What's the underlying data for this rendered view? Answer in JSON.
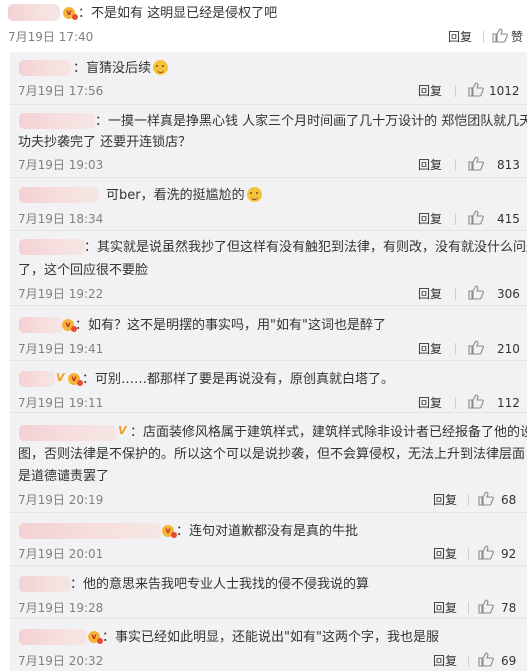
{
  "main_comment": {
    "text": "：不是如有 这明显已经是侵权了吧",
    "time": "7月19日 17:40",
    "reply_label": "回复",
    "likes": "赞"
  },
  "replies": [
    {
      "text": "：盲猜没后续",
      "time": "7月19日 17:56",
      "reply_label": "回复",
      "likes": "1012"
    },
    {
      "text_line1": "：一摸一样真是挣黑心钱 人家三个月时间画了几十万设计的 郑恺团队就几天的",
      "text_line2": "功夫抄袭完了 还要开连锁店？",
      "time": "7月19日 19:03",
      "reply_label": "回复",
      "likes": "813"
    },
    {
      "text": "可ber，看洗的挺尴尬的",
      "time": "7月19日 18:34",
      "reply_label": "回复",
      "likes": "415"
    },
    {
      "text_line1": "：其实就是说虽然我抄了但这样有没有触犯到法律，有则改，没有就没什么问题",
      "text_line2": "了，这个回应很不要脸",
      "time": "7月19日 19:22",
      "reply_label": "回复",
      "likes": "306"
    },
    {
      "text": "：如有？这不是明摆的事实吗，用\"如有\"这词也是醉了",
      "time": "7月19日 19:41",
      "reply_label": "回复",
      "likes": "210"
    },
    {
      "text": "：可别……都那样了要是再说没有，原创真就白塔了。",
      "time": "7月19日 19:11",
      "reply_label": "回复",
      "likes": "112"
    },
    {
      "text_line1": "：店面装修风格属于建筑样式，建筑样式除非设计者已经报备了他的设计",
      "text_line2": "图，否则法律是不保护的。所以这个可以是说抄袭，但不会算侵权，无法上升到法律层面，只",
      "text_line3": "是道德谴责罢了",
      "time": "7月19日 20:19",
      "reply_label": "回复",
      "likes": "68"
    },
    {
      "text": "：连句对道歉都没有是真的牛批",
      "time": "7月19日 20:01",
      "reply_label": "回复",
      "likes": "92"
    },
    {
      "text": "：他的意思来告我吧专业人士我找的侵不侵我说的算",
      "time": "7月19日 19:28",
      "reply_label": "回复",
      "likes": "78"
    },
    {
      "text": "：事实已经如此明显，还能说出\"如有\"这两个字，我也是服",
      "time": "7月19日 20:32",
      "reply_label": "回复",
      "likes": "69"
    }
  ],
  "colors": {
    "background": "#ffffff",
    "reply_panel": "#f2f2f5",
    "time_gray": "#808080",
    "badge_gold": "#f4b43a",
    "username_blur": "#f3d1d3"
  },
  "icons": {
    "like": "thumbs-up-icon",
    "member_badge": "vip-badge-icon",
    "verified": "verified-v-icon",
    "emoji": "emoji-icon"
  }
}
